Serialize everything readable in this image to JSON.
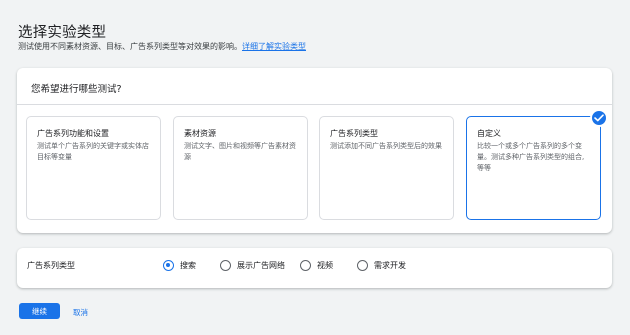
{
  "header": {
    "title": "选择实验类型",
    "subtitle": "测试使用不同素材资源、目标、广告系列类型等对效果的影响。",
    "learn_more_link": "详细了解实验类型"
  },
  "tests_card": {
    "question": "您希望进行哪些测试?",
    "options": [
      {
        "title": "广告系列功能和设置",
        "desc": "测试单个广告系列的关键字或实体店目标等变量",
        "selected": false
      },
      {
        "title": "素材资源",
        "desc": "测试文字、图片和视频等广告素材资源",
        "selected": false
      },
      {
        "title": "广告系列类型",
        "desc": "测试添加不同广告系列类型后的效果",
        "selected": false
      },
      {
        "title": "自定义",
        "desc": "比较一个或多个广告系列的多个变量。测试多种广告系列类型的组合,等等",
        "selected": true
      }
    ]
  },
  "campaign_type": {
    "label": "广告系列类型",
    "options": [
      {
        "label": "搜索",
        "selected": true
      },
      {
        "label": "展示广告网络",
        "selected": false
      },
      {
        "label": "视频",
        "selected": false
      },
      {
        "label": "需求开发",
        "selected": false
      }
    ]
  },
  "footer": {
    "continue_label": "继续",
    "cancel_label": "取消"
  },
  "colors": {
    "accent": "#1a73e8",
    "background": "#f1f3f4"
  }
}
